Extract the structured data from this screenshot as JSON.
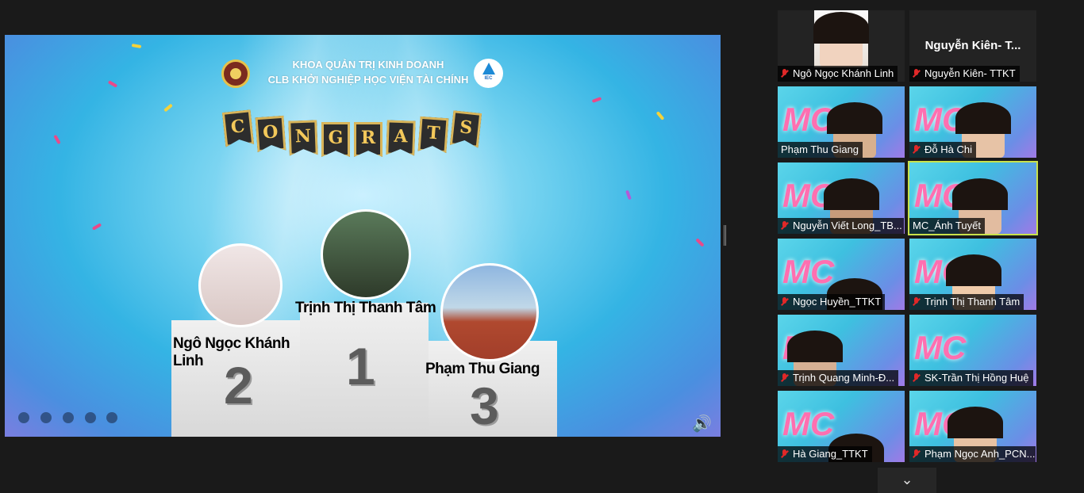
{
  "slide": {
    "header_line1": "KHOA QUẢN TRỊ KINH DOANH",
    "header_line2": "CLB KHỞI NGHIỆP HỌC VIỆN TÀI CHÍNH",
    "logo2_text": "IEC",
    "banner_letters": [
      "C",
      "O",
      "N",
      "G",
      "R",
      "A",
      "T",
      "S"
    ],
    "podium": [
      {
        "rank": "1",
        "name": "Trịnh Thị Thanh Tâm"
      },
      {
        "rank": "2",
        "name": "Ngô Ngọc Khánh Linh"
      },
      {
        "rank": "3",
        "name": "Phạm Thu Giang"
      }
    ]
  },
  "controls": [
    "prev-icon",
    "next-icon",
    "pen-icon",
    "zoom-icon",
    "more-icon",
    "speaker-icon"
  ],
  "participants": [
    {
      "name": "Ngô Ngọc Khánh Linh",
      "muted": true,
      "video": true
    },
    {
      "name": "Nguyễn Kiên- TTKT",
      "muted": true,
      "video": false,
      "display": "Nguyễn Kiên- T..."
    },
    {
      "name": "Phạm Thu Giang",
      "muted": false,
      "video": true
    },
    {
      "name": "Đỗ Hà Chi",
      "muted": true,
      "video": true
    },
    {
      "name": "Nguyễn Viết Long_TB...",
      "muted": true,
      "video": true
    },
    {
      "name": "MC_Ánh Tuyết",
      "muted": false,
      "video": true,
      "active": true
    },
    {
      "name": "Ngọc Huyền_TTKT",
      "muted": true,
      "video": true
    },
    {
      "name": "Trịnh Thị Thanh Tâm",
      "muted": true,
      "video": true
    },
    {
      "name": "Trịnh Quang Minh-Đ...",
      "muted": true,
      "video": true
    },
    {
      "name": "SK-Trần Thị Hồng Huệ",
      "muted": true,
      "video": true
    },
    {
      "name": "Hà Giang_TTKT",
      "muted": true,
      "video": true
    },
    {
      "name": "Phạm Ngọc Anh_PCN...",
      "muted": true,
      "video": true
    }
  ],
  "more_label": "⌄"
}
